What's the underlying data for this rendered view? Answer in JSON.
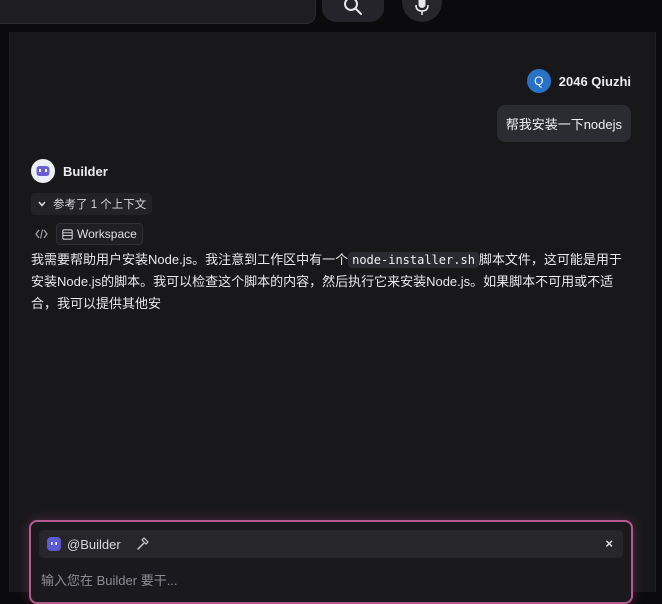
{
  "top": {
    "search_icon": "search-icon",
    "mic_icon": "microphone-icon"
  },
  "user": {
    "avatar_initial": "Q",
    "name": "2046 Qiuzhi",
    "message": "帮我安装一下nodejs",
    "avatar_color": "#2a72c6"
  },
  "bot": {
    "name": "Builder",
    "context_toggle": "参考了 1 个上下文",
    "workspace_label": "Workspace",
    "message_part1": "我需要帮助用户安装Node.js。我注意到工作区中有一个",
    "message_code": "node-installer.sh",
    "message_part2": "脚本文件，这可能是用于安装Node.js的脚本。我可以检查这个脚本的内容，然后执行它来安装Node.js。如果脚本不可用或不适合，我可以提供其他安"
  },
  "composer": {
    "mention": "@Builder",
    "close": "×",
    "placeholder": "输入您在 Builder 要干..."
  }
}
